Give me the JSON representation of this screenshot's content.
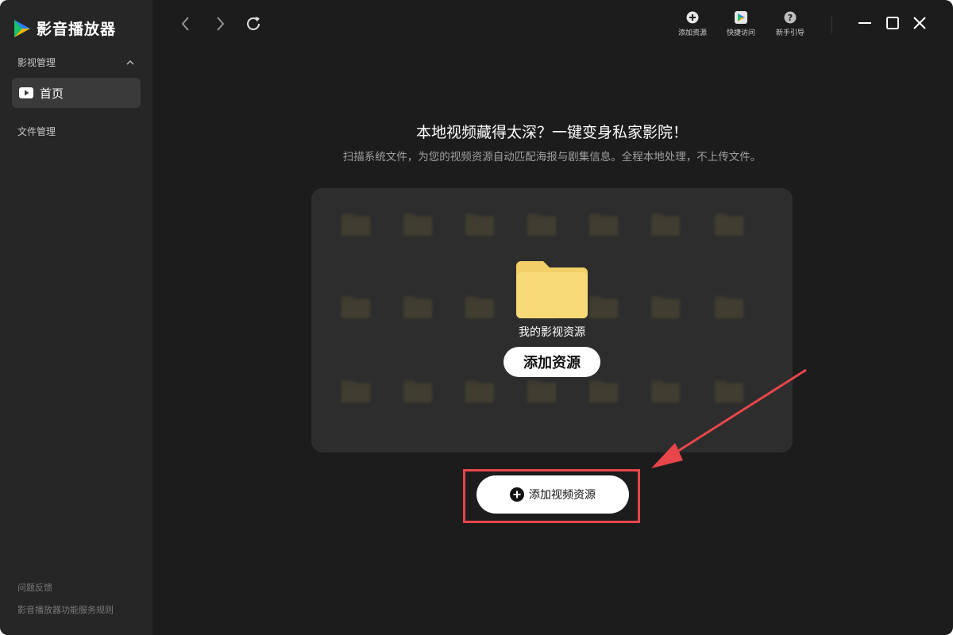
{
  "app": {
    "name": "影音播放器"
  },
  "sidebar": {
    "section_video": "影视管理",
    "home_label": "首页",
    "section_file": "文件管理",
    "feedback": "问题反馈",
    "rules": "影音播放器功能服务规则"
  },
  "toolbar": {
    "add_resource": "添加资源",
    "quick_access": "快捷访问",
    "guide": "新手引导"
  },
  "main": {
    "headline": "本地视频藏得太深？一键变身私家影院！",
    "subline": "扫描系统文件，为您的视频资源自动匹配海报与剧集信息。全程本地处理，不上传文件。",
    "folder_label": "我的影视资源",
    "panel_button": "添加资源",
    "add_video_button": "添加视频资源"
  },
  "colors": {
    "highlight": "#e8464a",
    "folder": "#f7d978",
    "background": "#1c1c1c",
    "sidebar": "#262626"
  },
  "icons": {
    "logo": "play-triangle-logo-icon",
    "home": "video-play-icon",
    "add": "plus-circle-icon",
    "quick": "quick-access-icon",
    "guide": "question-circle-icon"
  }
}
